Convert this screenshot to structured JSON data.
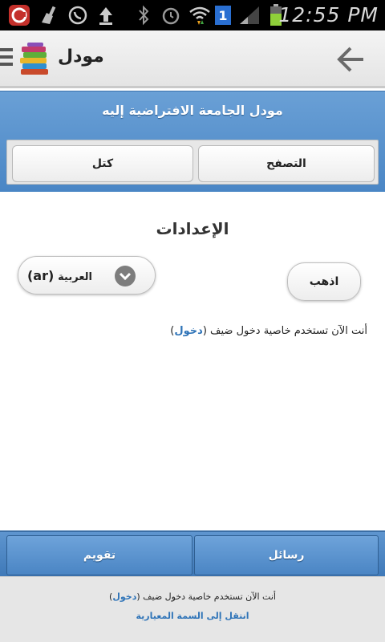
{
  "status_bar": {
    "time": "12:55 PM",
    "icons": [
      "app-notification-icon",
      "cleaner-icon",
      "whatsapp-icon",
      "upload-icon",
      "bluetooth-icon",
      "alarm-icon",
      "wifi-icon",
      "sim-1-icon",
      "signal-icon",
      "battery-icon"
    ],
    "sim_label": "1"
  },
  "action_bar": {
    "title": "مودل",
    "icons": [
      "menu-icon",
      "app-logo-books-icon",
      "back-arrow-icon"
    ]
  },
  "header": {
    "site_title": "مودل الجامعة الافتراضية إليه",
    "nav": {
      "browse_label": "التصفح",
      "blocks_label": "كتل"
    }
  },
  "main": {
    "heading": "الإعدادات",
    "language_select": {
      "selected_name": "العربية",
      "selected_code": "(ar)",
      "icon": "chevron-down-icon"
    },
    "go_label": "اذهب",
    "guest_notice": {
      "text": "أنت الآن تستخدم خاصية دخول ضيف",
      "open": "(",
      "link": "دخول",
      "close": ")"
    }
  },
  "bottom_nav": {
    "calendar_label": "تقويم",
    "messages_label": "رسائل"
  },
  "footer": {
    "guest_notice": {
      "text": "أنت الآن تستخدم خاصية دخول ضيف",
      "open": "(",
      "link": "دخول",
      "close": ")"
    },
    "standard_theme_link": "انتقل إلى السمة المعيارية"
  },
  "colors": {
    "header_blue": "#4a86c5",
    "link_blue": "#2f74b8",
    "status_bar": "#000000"
  }
}
